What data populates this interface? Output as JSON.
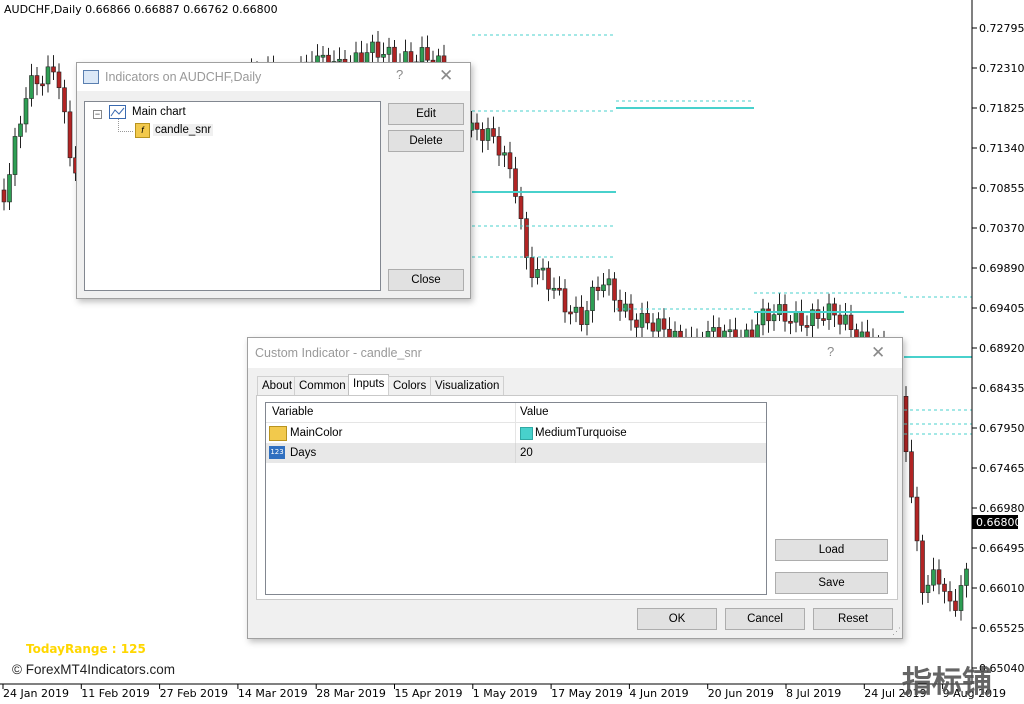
{
  "chart": {
    "symbol_ohlc": "AUDCHF,Daily  0.66866 0.66887 0.66762 0.66800",
    "price_ticks": [
      "0.72795",
      "0.72310",
      "0.71825",
      "0.71340",
      "0.70855",
      "0.70370",
      "0.69890",
      "0.69405",
      "0.68920",
      "0.68435",
      "0.67950",
      "0.67465",
      "0.66980",
      "0.66495",
      "0.66010",
      "0.65525",
      "0.65040"
    ],
    "current_price": "0.66800",
    "date_ticks": [
      "24 Jan 2019",
      "11 Feb 2019",
      "27 Feb 2019",
      "14 Mar 2019",
      "28 Mar 2019",
      "15 Apr 2019",
      "1 May 2019",
      "17 May 2019",
      "4 Jun 2019",
      "20 Jun 2019",
      "8 Jul 2019",
      "24 Jul 2019",
      "9 Aug 2019"
    ],
    "today_range": "TodayRange : 125",
    "watermark": "© ForexMT4Indicators.com",
    "corner_logo": "指标铺",
    "colors": {
      "bull": "#2e9e54",
      "bear": "#b22424",
      "level": "#48d1cc",
      "today": "#ffd700"
    }
  },
  "indicators_dialog": {
    "title": "Indicators on AUDCHF,Daily",
    "help": "?",
    "tree_root": "Main chart",
    "tree_child": "candle_snr",
    "buttons": {
      "edit": "Edit",
      "delete": "Delete",
      "close": "Close"
    }
  },
  "custom_dialog": {
    "title": "Custom Indicator - candle_snr",
    "help": "?",
    "tabs": [
      "About",
      "Common",
      "Inputs",
      "Colors",
      "Visualization"
    ],
    "active_tab": "Inputs",
    "columns": {
      "variable": "Variable",
      "value": "Value"
    },
    "rows": [
      {
        "icon": "color-param-icon",
        "variable": "MainColor",
        "value": "MediumTurquoise",
        "swatch": "#48d1cc"
      },
      {
        "icon": "number-param-icon",
        "variable": "Days",
        "value": "20",
        "icon_text": "123"
      }
    ],
    "buttons": {
      "load": "Load",
      "save": "Save",
      "ok": "OK",
      "cancel": "Cancel",
      "reset": "Reset"
    }
  }
}
